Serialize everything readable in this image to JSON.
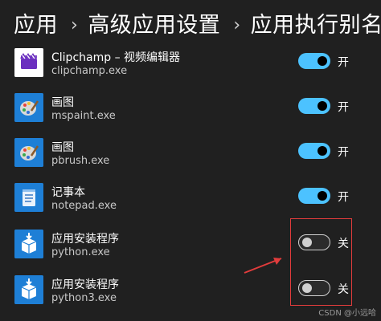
{
  "breadcrumb": {
    "items": [
      "应用",
      "高级应用设置",
      "应用执行别名"
    ],
    "separator": "›"
  },
  "apps": [
    {
      "name": "Clipchamp – 视频编辑器",
      "exe": "clipchamp.exe",
      "icon": "clipchamp-icon",
      "enabled": true,
      "state_label": "开"
    },
    {
      "name": "画图",
      "exe": "mspaint.exe",
      "icon": "paint-palette-icon",
      "enabled": true,
      "state_label": "开"
    },
    {
      "name": "画图",
      "exe": "pbrush.exe",
      "icon": "paint-palette-icon",
      "enabled": true,
      "state_label": "开"
    },
    {
      "name": "记事本",
      "exe": "notepad.exe",
      "icon": "notepad-icon",
      "enabled": true,
      "state_label": "开"
    },
    {
      "name": "应用安装程序",
      "exe": "python.exe",
      "icon": "app-installer-icon",
      "enabled": false,
      "state_label": "关"
    },
    {
      "name": "应用安装程序",
      "exe": "python3.exe",
      "icon": "app-installer-icon",
      "enabled": false,
      "state_label": "关"
    }
  ],
  "colors": {
    "background": "#202020",
    "toggle_on": "#4cc2ff",
    "annotation": "#e23c3c"
  },
  "watermark": "CSDN @小远哈"
}
